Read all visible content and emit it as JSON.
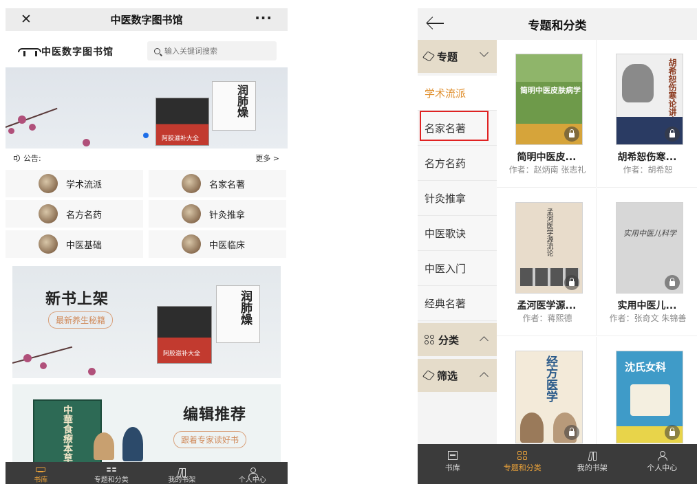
{
  "left": {
    "top_bar": {
      "close": "✕",
      "title": "中医数字图书馆",
      "more": "···"
    },
    "logo_text": "中医数字图书馆",
    "search": {
      "placeholder": "输入关键词搜索"
    },
    "banner": {
      "book_title": "润肺燥",
      "book_sub": "阿胶滋补大全",
      "active_dot": 1
    },
    "notice": {
      "label": "公告:",
      "more": "更多 >"
    },
    "categories": [
      {
        "label": "学术流派"
      },
      {
        "label": "名家名著"
      },
      {
        "label": "名方名药"
      },
      {
        "label": "针灸推拿"
      },
      {
        "label": "中医基础"
      },
      {
        "label": "中医临床"
      }
    ],
    "promo1": {
      "title": "新书上架",
      "tag": "最新养生秘籍",
      "book_title": "润肺燥",
      "book_sub": "阿胶滋补大全"
    },
    "promo2": {
      "title": "编辑推荐",
      "tag": "跟着专家读好书",
      "book_title": "中華食療本草"
    },
    "tabs": [
      {
        "label": "书库",
        "active": true
      },
      {
        "label": "专题和分类",
        "active": false
      },
      {
        "label": "我的书架",
        "active": false
      },
      {
        "label": "个人中心",
        "active": false
      }
    ],
    "accent": "#e8a13a"
  },
  "right": {
    "top_bar": {
      "title": "专题和分类"
    },
    "sections": [
      {
        "label": "专题",
        "expanded": true
      },
      {
        "label": "分类",
        "expanded": false
      },
      {
        "label": "筛选",
        "expanded": false
      }
    ],
    "topics": [
      "学术流派",
      "名家名著",
      "名方名药",
      "针灸推拿",
      "中医歌诀",
      "中医入门",
      "经典名著"
    ],
    "selected_topic": "学术流派",
    "books": [
      {
        "title": "简明中医皮...",
        "author": "作者：赵炳南 张志礼",
        "cover_text": "简明中医皮肤病学",
        "cover_color": "#6e9a4a",
        "locked": true
      },
      {
        "title": "胡希恕伤寒...",
        "author": "作者：胡希恕",
        "cover_text": "胡希恕伤寒论讲座",
        "cover_color": "#eeeeee",
        "locked": true
      },
      {
        "title": "孟河医学源...",
        "author": "作者：蒋熙德",
        "cover_text": "孟河医学源流论",
        "cover_color": "#e8dccb",
        "locked": true
      },
      {
        "title": "实用中医儿...",
        "author": "作者：张奇文 朱锦善",
        "cover_text": "实用中医儿科学",
        "cover_color": "#d7d7d7",
        "locked": true
      },
      {
        "title": "",
        "author": "",
        "cover_text": "经方医学",
        "cover_color": "#f3ead9",
        "locked": true
      },
      {
        "title": "",
        "author": "",
        "cover_text": "沈氏女科",
        "cover_color": "#3f9bc8",
        "locked": true
      }
    ],
    "tabs": [
      {
        "label": "书库",
        "active": false
      },
      {
        "label": "专题和分类",
        "active": true
      },
      {
        "label": "我的书架",
        "active": false
      },
      {
        "label": "个人中心",
        "active": false
      }
    ],
    "highlight_color": "#e02222"
  }
}
